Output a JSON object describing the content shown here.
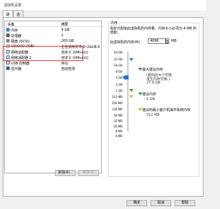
{
  "window": {
    "title": "虚拟机设置"
  },
  "tabs": [
    {
      "label": "硬件"
    },
    {
      "label": "选项"
    }
  ],
  "device_list": {
    "headers": {
      "device": "设备",
      "summary": "摘要"
    },
    "rows": [
      {
        "device": "内存",
        "summary": "4 GB",
        "icon": "memory-icon"
      },
      {
        "device": "处理器",
        "summary": "1",
        "icon": "processor-icon"
      },
      {
        "device": "硬盘 (SCSI)",
        "summary": "200 GB",
        "icon": "hard-disk-icon"
      },
      {
        "device": "CD/DVD (IDE)",
        "summary": "正在使用文件 D:\\iSo\\B-Kyrbk...",
        "icon": "cd-dvd-icon"
      },
      {
        "device": "网络适配器",
        "summary": "自定义 (VMnet1)",
        "icon": "network-adapter-icon"
      },
      {
        "device": "网络适配器 2",
        "summary": "自定义 (VMnet1)",
        "icon": "network-adapter-icon"
      },
      {
        "device": "USB 控制器",
        "summary": "存在",
        "icon": "usb-controller-icon"
      },
      {
        "device": "显示器",
        "summary": "自动检测",
        "icon": "display-icon"
      }
    ],
    "highlight_color": "#e0363c"
  },
  "buttons": {
    "add": "添加(A)...",
    "remove": "移除(R)",
    "ok": "确定",
    "cancel": "取消",
    "help": "帮助"
  },
  "memory": {
    "group_title": "内存",
    "description": "指定分配给此虚拟机的内存量。内存大小必须为 4 MB 的倍数。",
    "field_label": "此虚拟机的内存(M):",
    "value": "4096",
    "unit": "MB",
    "scale": [
      "64 GB",
      "32 GB",
      "16 GB",
      "8 GB",
      "4 GB",
      "2 GB",
      "1 GB",
      "512 MB",
      "256 MB",
      "128 MB",
      "64 MB",
      "32 MB",
      "16 MB",
      "8 MB",
      "4 MB"
    ],
    "legend": [
      {
        "title": "最大建议内存",
        "sub": [
          "(超出此大小可能",
          "发生内存交换。)",
          "27.9 GB"
        ],
        "color": "#1e73d2"
      },
      {
        "title": "建议内存",
        "sub": [
          "1 GB"
        ],
        "color": "#2e9b2e"
      },
      {
        "title": "建议的最小客户机操作系统内存",
        "sub": [
          "512 MB"
        ],
        "color": "#e1b21c"
      }
    ]
  }
}
